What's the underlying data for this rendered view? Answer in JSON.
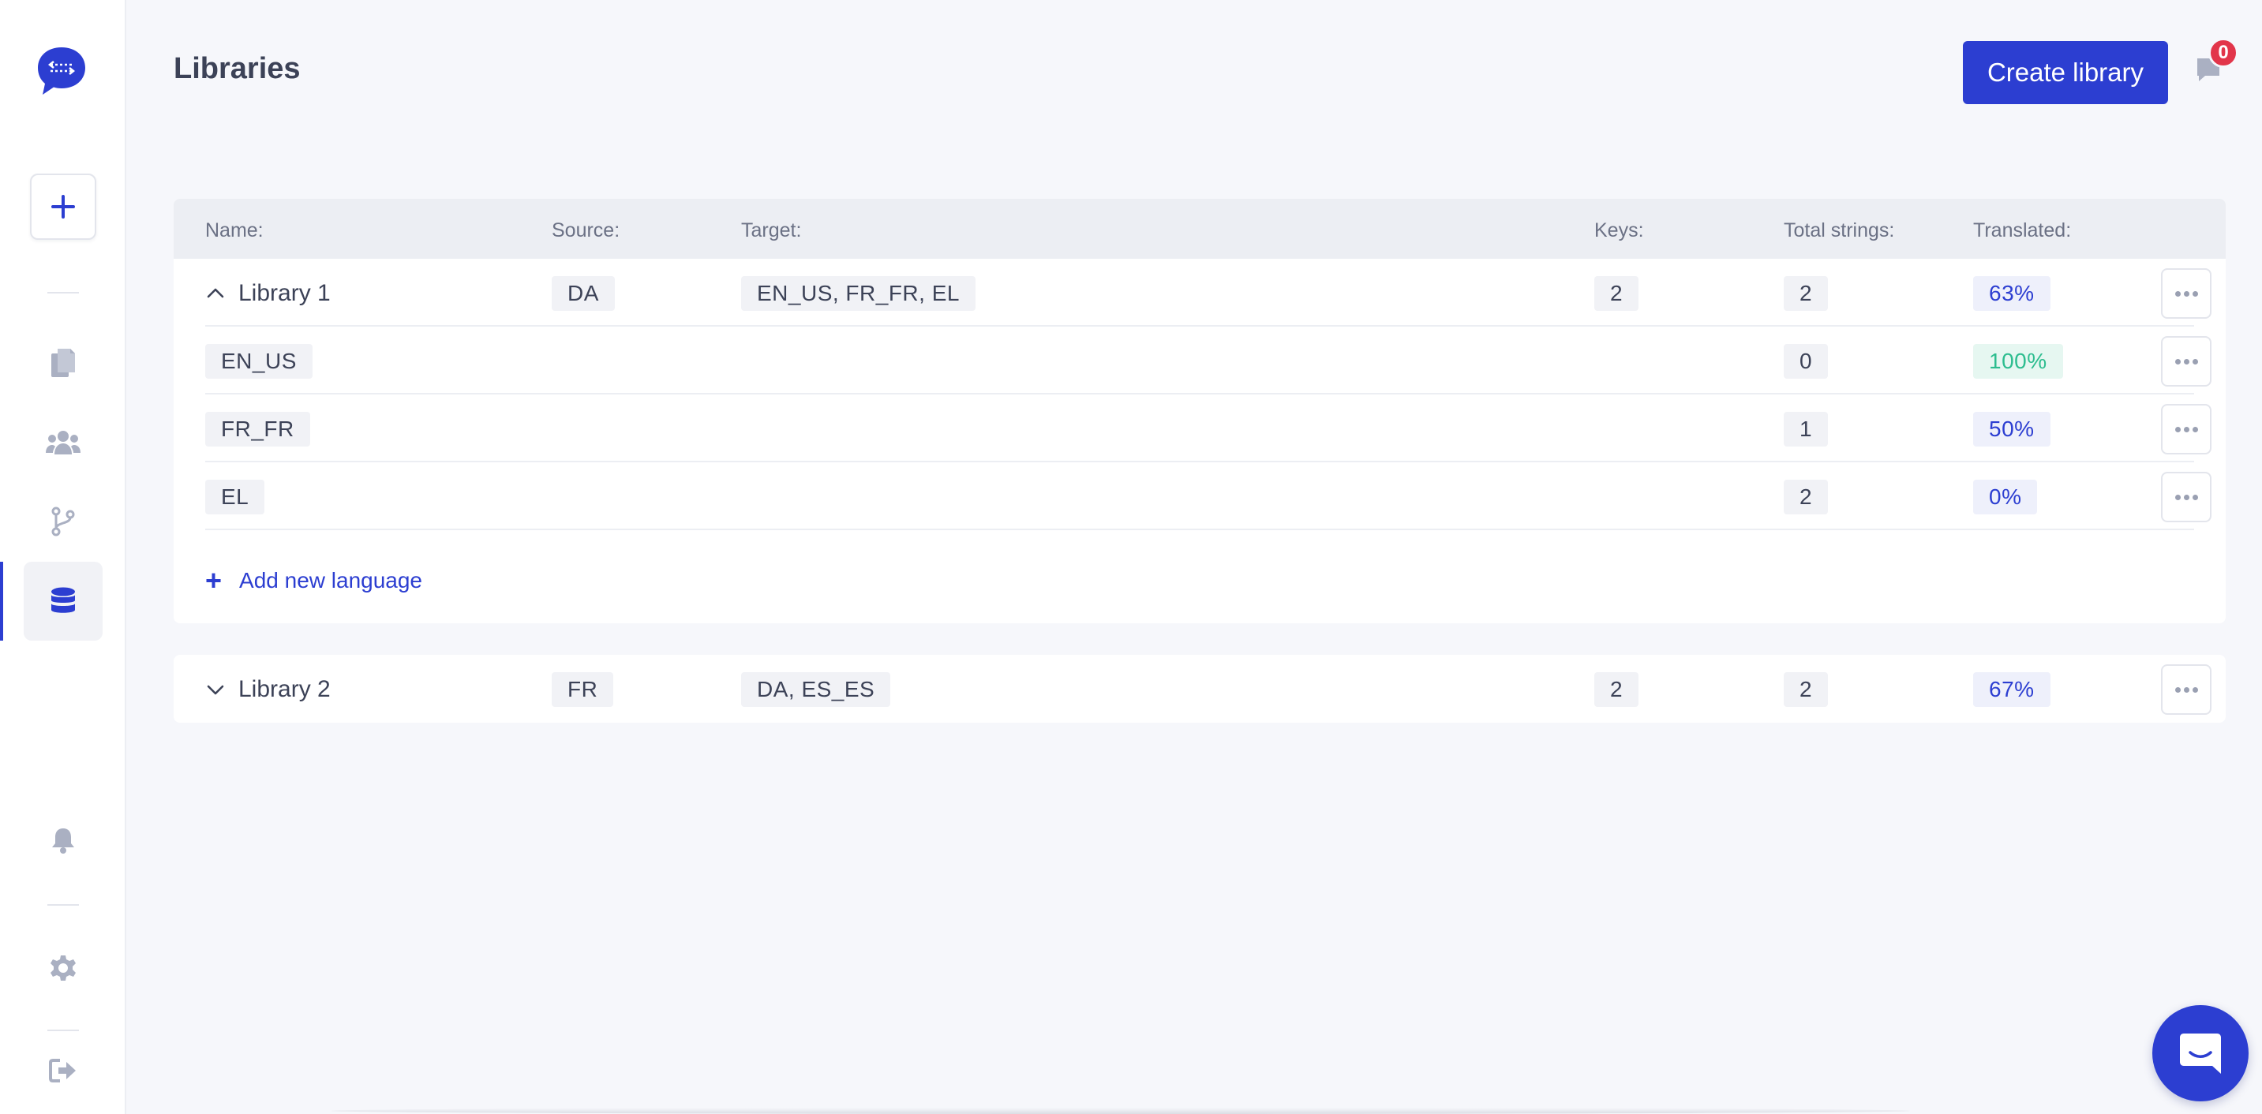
{
  "header": {
    "title": "Libraries",
    "create_label": "Create library",
    "notification_count": "0"
  },
  "sidebar": {
    "items": [
      {
        "icon": "documents-icon",
        "name": "documents"
      },
      {
        "icon": "users-icon",
        "name": "team"
      },
      {
        "icon": "branch-icon",
        "name": "branches"
      },
      {
        "icon": "database-icon",
        "name": "libraries",
        "active": true
      },
      {
        "icon": "bell-icon",
        "name": "notifications"
      },
      {
        "icon": "gear-icon",
        "name": "settings"
      },
      {
        "icon": "logout-icon",
        "name": "logout"
      }
    ]
  },
  "table": {
    "headers": {
      "name": "Name:",
      "source": "Source:",
      "target": "Target:",
      "keys": "Keys:",
      "total": "Total strings:",
      "translated": "Translated:"
    },
    "libraries": [
      {
        "name": "Library 1",
        "expanded": true,
        "source": "DA",
        "target": "EN_US, FR_FR, EL",
        "keys": "2",
        "total": "2",
        "translated": "63%",
        "languages": [
          {
            "code": "EN_US",
            "total": "0",
            "translated": "100%"
          },
          {
            "code": "FR_FR",
            "total": "1",
            "translated": "50%"
          },
          {
            "code": "EL",
            "total": "2",
            "translated": "0%"
          }
        ],
        "add_language_label": "Add new language"
      },
      {
        "name": "Library 2",
        "expanded": false,
        "source": "FR",
        "target": "DA, ES_ES",
        "keys": "2",
        "total": "2",
        "translated": "67%"
      }
    ]
  },
  "colors": {
    "accent": "#2c3ed1",
    "success": "#2dbd8f",
    "badge": "#e2354a"
  }
}
